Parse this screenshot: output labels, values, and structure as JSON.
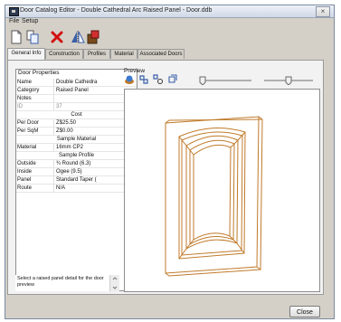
{
  "window": {
    "title": "Door Catalog Editor - Double Cathedral Arc Raised Panel - Door.ddb",
    "close_glyph": "×"
  },
  "menu": [
    "File",
    "Setup"
  ],
  "toolbar": {
    "icons": [
      "new-document-icon",
      "copy-document-icon",
      "delete-icon",
      "mirror-icon",
      "import-icon"
    ]
  },
  "tabs": [
    {
      "label": "General Info",
      "active": true
    },
    {
      "label": "Construction",
      "active": false
    },
    {
      "label": "Profiles",
      "active": false
    },
    {
      "label": "Material",
      "active": false
    },
    {
      "label": "Associated Doors",
      "active": false
    }
  ],
  "properties": {
    "header": "Door Properties",
    "rows": [
      {
        "key": "Name",
        "value": "Double Cathedra"
      },
      {
        "key": "Category",
        "value": "Raised Panel"
      },
      {
        "key": "Notes",
        "value": ""
      },
      {
        "key": "ID",
        "value": "37"
      },
      {
        "section": "Cost"
      },
      {
        "key": "Per Door",
        "value": "Z$25.50"
      },
      {
        "key": "Per SqM",
        "value": "Z$0.00"
      },
      {
        "section": "Sample Material"
      },
      {
        "key": "Material",
        "value": "16mm CP2"
      },
      {
        "section": "Sample Profile"
      },
      {
        "key": "Outside",
        "value": "¾ Round (6.3)"
      },
      {
        "key": "Inside",
        "value": "Ogee (9.5)"
      },
      {
        "key": "Panel",
        "value": "Standard Taper ("
      },
      {
        "key": "Route",
        "value": "N/A"
      }
    ]
  },
  "help_text": "Select a raised panel detail for the door preview",
  "preview": {
    "label": "Preview",
    "tools": [
      "render-icon",
      "move-icon",
      "zoom-icon",
      "rotate-icon"
    ]
  },
  "close_button": "Close",
  "colors": {
    "door_outline": "#c07a2a",
    "window_bg": "#d4d0c8",
    "delete": "#d21010"
  }
}
